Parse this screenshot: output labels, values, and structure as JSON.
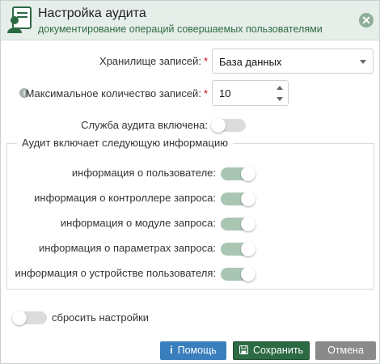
{
  "dialog": {
    "title": "Настройка аудита",
    "subtitle": "документирование операций совершаемых пользователями",
    "close_icon": "close-icon",
    "header_icon": "user-document-icon"
  },
  "form": {
    "storage_label": "Хранилище записей:",
    "storage_value": "База данных",
    "max_records_label": "Максимальное количество записей:",
    "max_records_value": "10",
    "required_mark": "*",
    "service_label": "Служба аудита включена:",
    "service_enabled": false
  },
  "audit_info": {
    "legend": "Аудит включает следующую информацию",
    "items": [
      {
        "label": "информация о пользователе:",
        "enabled": true
      },
      {
        "label": "информация о контроллере запроса:",
        "enabled": true
      },
      {
        "label": "информация о модуле запроса:",
        "enabled": true
      },
      {
        "label": "информация о параметрах запроса:",
        "enabled": true
      },
      {
        "label": "информация о устройстве пользователя:",
        "enabled": true
      }
    ]
  },
  "reset": {
    "label": "сбросить настройки",
    "enabled": false
  },
  "buttons": {
    "help": "Помощь",
    "save": "Сохранить",
    "cancel": "Отмена"
  },
  "colors": {
    "header_bg": "#e6eee9",
    "toggle_on": "#a9c6b3",
    "save_button": "#2c6a44",
    "help_button": "#3a7fbd",
    "cancel_button": "#8a8a8a"
  }
}
